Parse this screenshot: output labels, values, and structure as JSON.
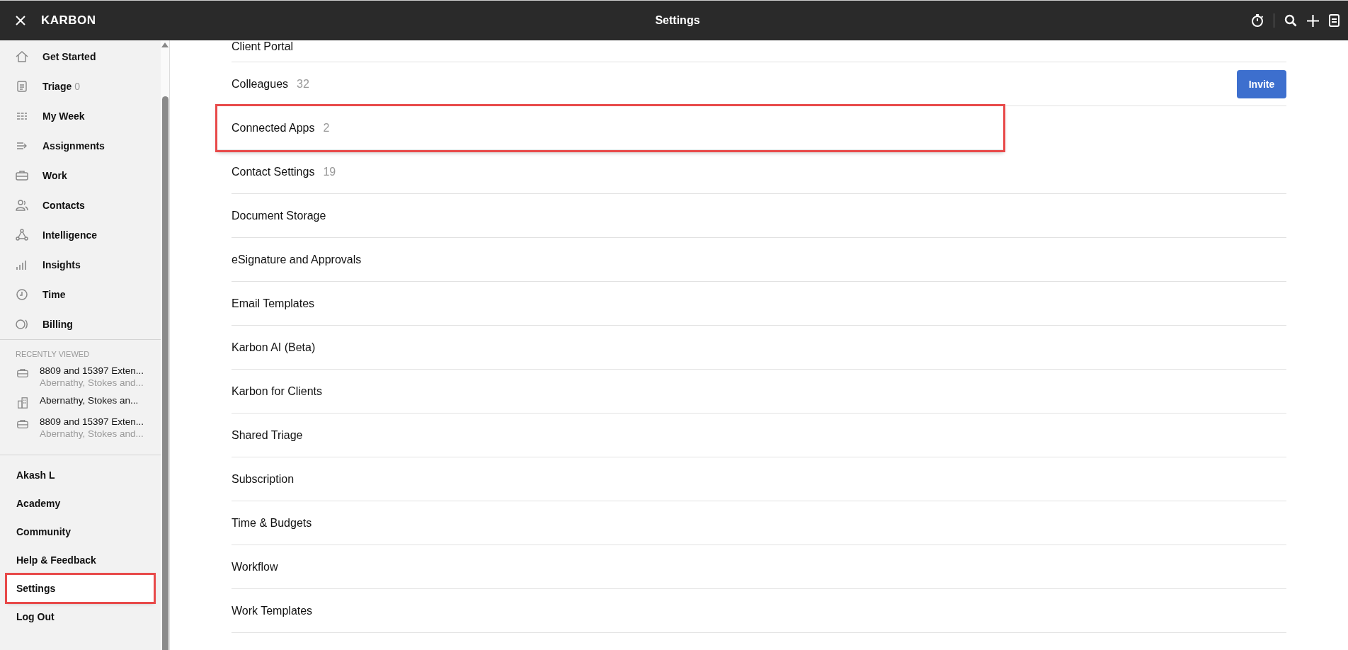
{
  "header": {
    "brand": "KARBON",
    "title": "Settings"
  },
  "sidebar": {
    "nav": [
      {
        "label": "Get Started"
      },
      {
        "label": "Triage",
        "count": "0"
      },
      {
        "label": "My Week"
      },
      {
        "label": "Assignments"
      },
      {
        "label": "Work"
      },
      {
        "label": "Contacts"
      },
      {
        "label": "Intelligence"
      },
      {
        "label": "Insights"
      },
      {
        "label": "Time"
      },
      {
        "label": "Billing"
      }
    ],
    "recently_viewed": {
      "heading": "RECENTLY VIEWED",
      "items": [
        {
          "kind": "work",
          "title": "8809 and 15397 Exten...",
          "subtitle": "Abernathy, Stokes and..."
        },
        {
          "kind": "contact",
          "title": "Abernathy, Stokes an..."
        },
        {
          "kind": "work",
          "title": "8809 and 15397 Exten...",
          "subtitle": "Abernathy, Stokes and..."
        }
      ]
    },
    "footer": [
      {
        "label": "Akash L",
        "highlighted": false
      },
      {
        "label": "Academy",
        "highlighted": false
      },
      {
        "label": "Community",
        "highlighted": false
      },
      {
        "label": "Help & Feedback",
        "highlighted": false
      },
      {
        "label": "Settings",
        "highlighted": true
      },
      {
        "label": "Log Out",
        "highlighted": false
      }
    ]
  },
  "settings": [
    {
      "label": "Client Portal",
      "highlighted": false
    },
    {
      "label": "Colleagues",
      "count": "32",
      "button": "Invite",
      "highlighted": false
    },
    {
      "label": "Connected Apps",
      "count": "2",
      "highlighted": true
    },
    {
      "label": "Contact Settings",
      "count": "19",
      "highlighted": false
    },
    {
      "label": "Document Storage",
      "highlighted": false
    },
    {
      "label": "eSignature and Approvals",
      "highlighted": false
    },
    {
      "label": "Email Templates",
      "highlighted": false
    },
    {
      "label": "Karbon AI (Beta)",
      "highlighted": false
    },
    {
      "label": "Karbon for Clients",
      "highlighted": false
    },
    {
      "label": "Shared Triage",
      "highlighted": false
    },
    {
      "label": "Subscription",
      "highlighted": false
    },
    {
      "label": "Time & Budgets",
      "highlighted": false
    },
    {
      "label": "Workflow",
      "highlighted": false
    },
    {
      "label": "Work Templates",
      "highlighted": false
    }
  ]
}
